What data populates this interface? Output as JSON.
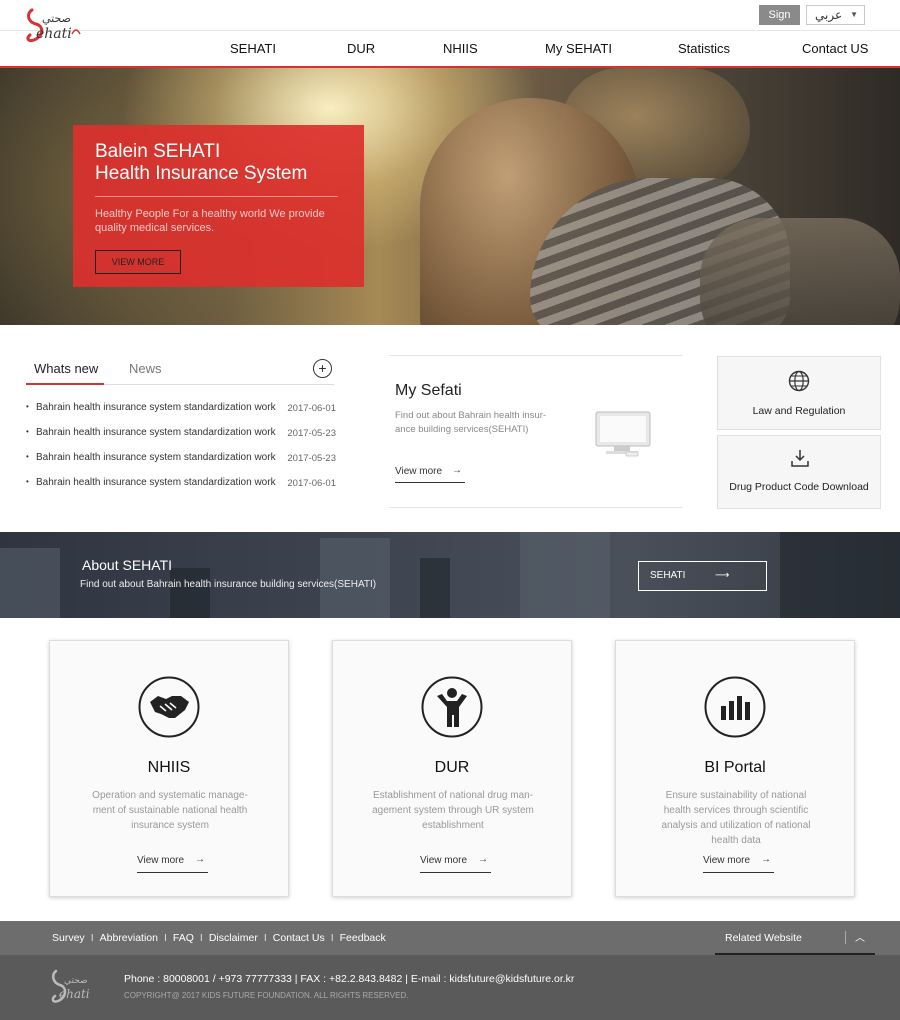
{
  "header": {
    "logo_text": "Sehati",
    "sign_label": "Sign",
    "language_selected": "عربي",
    "nav": [
      "SEHATI",
      "DUR",
      "NHIIS",
      "My SEHATI",
      "Statistics",
      "Contact US"
    ]
  },
  "hero": {
    "title_line1": "Balein SEHATI",
    "title_line2": "Health Insurance System",
    "description": "Healthy People For a healthy world We provide quality medical services.",
    "button_label": "VIEW MORE"
  },
  "news": {
    "tab_active": "Whats new",
    "tab_other": "News",
    "plus_icon": "+",
    "items": [
      {
        "title": "Bahrain health insurance system standardization work",
        "date": "2017-06-01"
      },
      {
        "title": "Bahrain health insurance system standardization work",
        "date": "2017-05-23"
      },
      {
        "title": "Bahrain health insurance system standardization work",
        "date": "2017-05-23"
      },
      {
        "title": "Bahrain health insurance system standardization work",
        "date": "2017-06-01"
      }
    ]
  },
  "sefati": {
    "title": "My Sefati",
    "description": "Find out about Bahrain health insur- ance building services(SEHATI)",
    "more_label": "View more",
    "arrow": "→"
  },
  "side_boxes": {
    "law_label": "Law and Regulation",
    "drug_label": "Drug Product Code Download"
  },
  "about": {
    "title": "About SEHATI",
    "description": "Find out about Bahrain health insurance building services(SEHATI)",
    "button_label": "SEHATI",
    "arrow": "⟶"
  },
  "cards": [
    {
      "title": "NHIIS",
      "description": "Operation and systematic manage- ment of sustainable national health insurance system",
      "more": "View more",
      "icon": "handshake-icon"
    },
    {
      "title": "DUR",
      "description": "Establishment of national drug man- agement system through UR system establishment",
      "more": "View more",
      "icon": "person-icon"
    },
    {
      "title": "BI Portal",
      "description": "Ensure sustainability of national health services through scientific analysis and utilization of national health data",
      "more": "View more",
      "icon": "bar-chart-icon"
    }
  ],
  "footer": {
    "links": [
      "Survey",
      "Abbreviation",
      "FAQ",
      "Disclaimer",
      "Contact Us",
      "Feedback"
    ],
    "separator": "I",
    "related_label": "Related Website",
    "up_icon": "︿",
    "contact": "Phone : 80008001 / +973 77777333  | FAX : +82.2.843.8482 | E-mail : kidsfuture@kidsfuture.or.kr",
    "copyright": "COPYRIGHT@ 2017 KIDS FUTURE FOUNDATION. ALL RIGHTS RESERVED."
  },
  "colors": {
    "accent": "#d8312f",
    "footer_top": "#6d6d6d",
    "footer_bottom": "#5a5a5a"
  }
}
